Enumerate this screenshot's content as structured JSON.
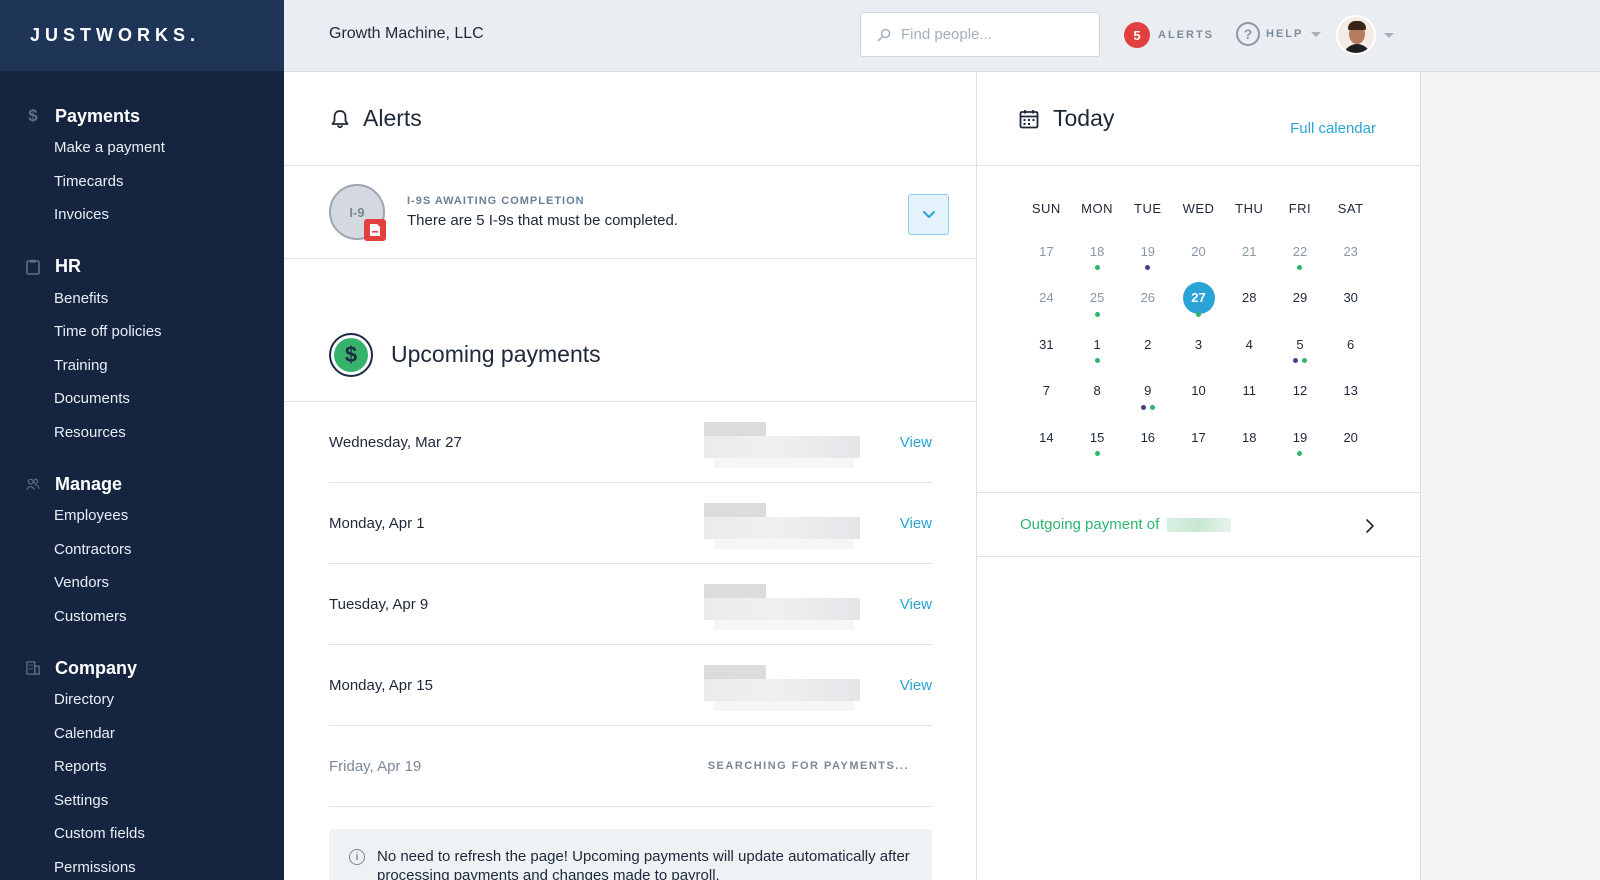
{
  "app": {
    "brand": "JUSTWORKS."
  },
  "sidebar": {
    "groups": [
      {
        "label": "Payments",
        "icon": "dollar-icon",
        "items": [
          "Make a payment",
          "Timecards",
          "Invoices"
        ]
      },
      {
        "label": "HR",
        "icon": "clipboard-icon",
        "items": [
          "Benefits",
          "Time off policies",
          "Training",
          "Documents",
          "Resources"
        ]
      },
      {
        "label": "Manage",
        "icon": "people-icon",
        "items": [
          "Employees",
          "Contractors",
          "Vendors",
          "Customers"
        ]
      },
      {
        "label": "Company",
        "icon": "building-icon",
        "items": [
          "Directory",
          "Calendar",
          "Reports",
          "Settings",
          "Custom fields",
          "Permissions"
        ]
      }
    ]
  },
  "topbar": {
    "company": "Growth Machine, LLC",
    "search_placeholder": "Find people...",
    "alerts_count": "5",
    "alerts_label": "ALERTS",
    "help_label": "HELP"
  },
  "alerts": {
    "title": "Alerts",
    "items": [
      {
        "badge": "I-9",
        "kicker": "I-9S AWAITING COMPLETION",
        "message": "There are 5 I-9s that must be completed."
      }
    ]
  },
  "payments": {
    "title": "Upcoming payments",
    "rows": [
      {
        "date": "Wednesday, Mar 27",
        "action": "View"
      },
      {
        "date": "Monday, Apr 1",
        "action": "View"
      },
      {
        "date": "Tuesday, Apr 9",
        "action": "View"
      },
      {
        "date": "Monday, Apr 15",
        "action": "View"
      }
    ],
    "pending": {
      "date": "Friday, Apr 19",
      "status": "SEARCHING FOR PAYMENTS..."
    },
    "info": "No need to refresh the page! Upcoming payments will update automatically after processing payments and changes made to payroll."
  },
  "today": {
    "title": "Today",
    "full_calendar": "Full calendar",
    "weekdays": [
      "SUN",
      "MON",
      "TUE",
      "WED",
      "THU",
      "FRI",
      "SAT"
    ],
    "weeks": [
      [
        {
          "n": "17",
          "dim": true
        },
        {
          "n": "18",
          "dim": true,
          "dots": [
            "g"
          ]
        },
        {
          "n": "19",
          "dim": true,
          "dots": [
            "p"
          ]
        },
        {
          "n": "20",
          "dim": true
        },
        {
          "n": "21",
          "dim": true
        },
        {
          "n": "22",
          "dim": true,
          "dots": [
            "g"
          ]
        },
        {
          "n": "23",
          "dim": true
        }
      ],
      [
        {
          "n": "24",
          "dim": true
        },
        {
          "n": "25",
          "dim": true,
          "dots": [
            "g"
          ]
        },
        {
          "n": "26",
          "dim": true
        },
        {
          "n": "27",
          "sel": true,
          "dots": [
            "g"
          ]
        },
        {
          "n": "28"
        },
        {
          "n": "29"
        },
        {
          "n": "30"
        }
      ],
      [
        {
          "n": "31"
        },
        {
          "n": "1",
          "dots": [
            "g"
          ]
        },
        {
          "n": "2"
        },
        {
          "n": "3"
        },
        {
          "n": "4"
        },
        {
          "n": "5",
          "dots": [
            "p",
            "g"
          ]
        },
        {
          "n": "6"
        }
      ],
      [
        {
          "n": "7"
        },
        {
          "n": "8"
        },
        {
          "n": "9",
          "dots": [
            "p",
            "g"
          ]
        },
        {
          "n": "10"
        },
        {
          "n": "11"
        },
        {
          "n": "12"
        },
        {
          "n": "13"
        }
      ],
      [
        {
          "n": "14"
        },
        {
          "n": "15",
          "dots": [
            "g"
          ]
        },
        {
          "n": "16"
        },
        {
          "n": "17"
        },
        {
          "n": "18"
        },
        {
          "n": "19",
          "dots": [
            "g"
          ]
        },
        {
          "n": "20"
        }
      ]
    ],
    "outgoing": "Outgoing payment of"
  },
  "colors": {
    "accent": "#2aa3d6",
    "sidebar": "#15243f",
    "brand_bar": "#1e3557",
    "success": "#2eb56f",
    "alert": "#e2403f",
    "event_purple": "#4b3c85"
  }
}
